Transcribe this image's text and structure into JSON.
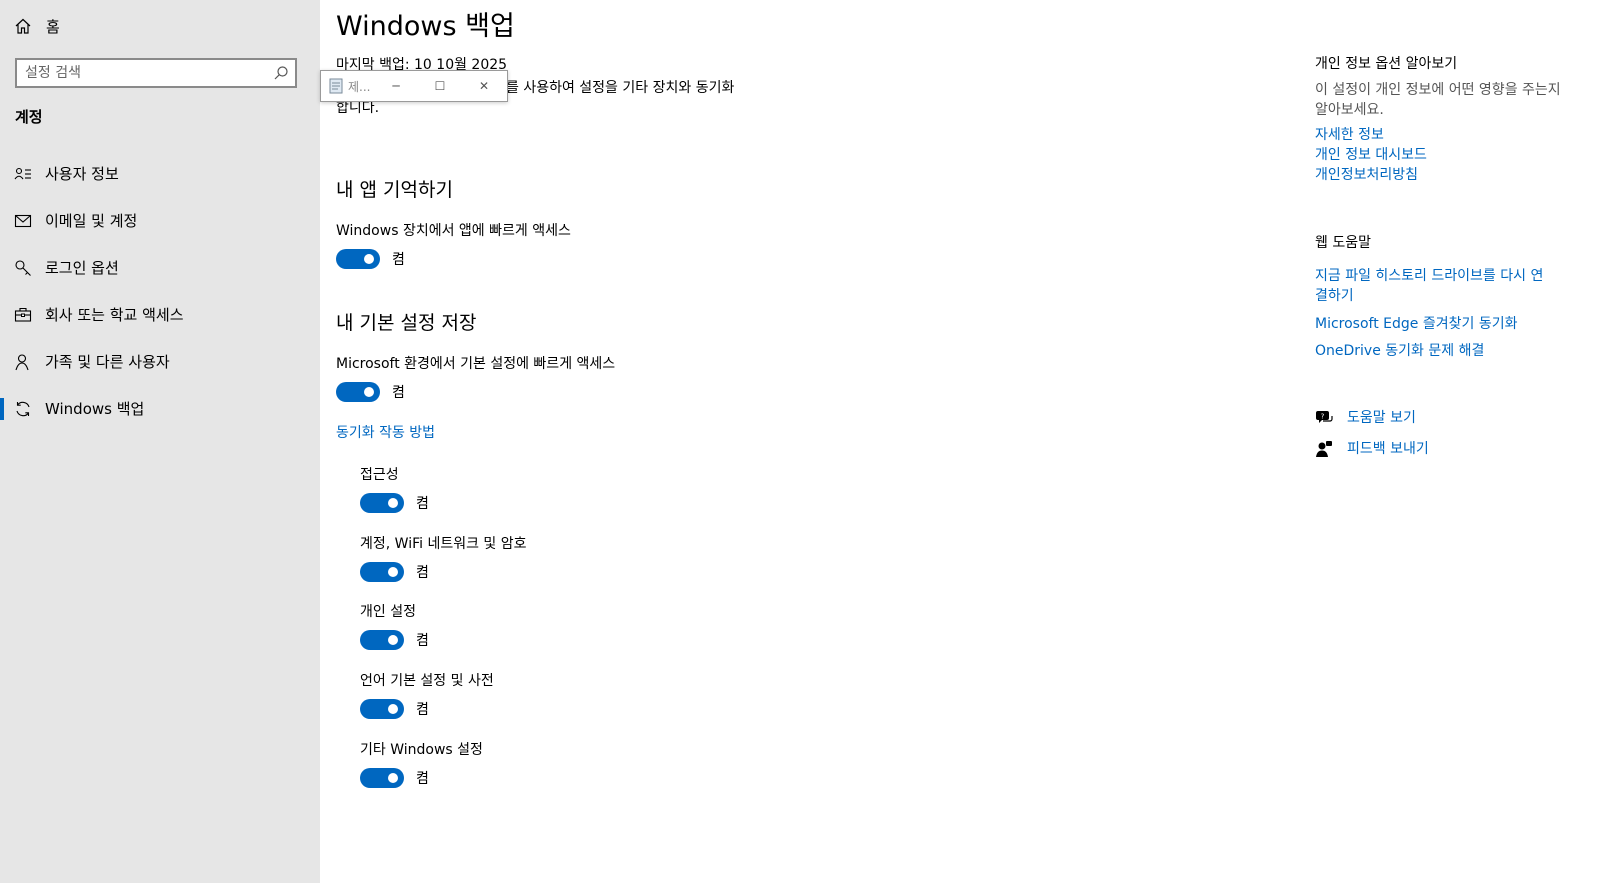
{
  "sidebar": {
    "home_label": "홈",
    "search_placeholder": "설정 검색",
    "section_title": "계정",
    "items": [
      {
        "label": "사용자 정보",
        "icon": "user-info-icon"
      },
      {
        "label": "이메일 및 계정",
        "icon": "mail-icon"
      },
      {
        "label": "로그인 옵션",
        "icon": "key-icon"
      },
      {
        "label": "회사 또는 학교 액세스",
        "icon": "briefcase-icon"
      },
      {
        "label": "가족 및 다른 사용자",
        "icon": "person-icon"
      },
      {
        "label": "Windows 백업",
        "icon": "sync-icon",
        "active": true
      }
    ]
  },
  "main": {
    "title": "Windows 백업",
    "last_backup": "마지막 백업: 10 10월 2025",
    "description_line1": "를 사용하여 설정을 기타 장치와 동기화",
    "description_line2": "합니다.",
    "remember_apps": {
      "heading": "내 앱 기억하기",
      "label": "Windows 장치에서 앱에 빠르게 액세스",
      "state": "켬"
    },
    "save_prefs": {
      "heading": "내 기본 설정 저장",
      "label": "Microsoft 환경에서 기본 설정에 빠르게 액세스",
      "state": "켬",
      "how_sync_link": "동기화 작동 방법",
      "subitems": [
        {
          "label": "접근성",
          "state": "켬"
        },
        {
          "label": "계정, WiFi 네트워크 및 암호",
          "state": "켬"
        },
        {
          "label": "개인 설정",
          "state": "켬"
        },
        {
          "label": "언어 기본 설정 및 사전",
          "state": "켬"
        },
        {
          "label": "기타 Windows 설정",
          "state": "켬"
        }
      ]
    }
  },
  "mini_window": {
    "title": "제...",
    "minimize": "─",
    "maximize": "☐",
    "close": "✕"
  },
  "right": {
    "privacy_heading": "개인 정보 옵션 알아보기",
    "privacy_text": "이 설정이 개인 정보에 어떤 영향을 주는지 알아보세요.",
    "privacy_links": [
      "자세한 정보",
      "개인 정보 대시보드",
      "개인정보처리방침"
    ],
    "web_help_heading": "웹 도움말",
    "web_help_links": [
      "지금 파일 히스토리 드라이브를 다시 연결하기",
      "Microsoft Edge 즐겨찾기 동기화",
      "OneDrive 동기화 문제 해결"
    ],
    "get_help": "도움말 보기",
    "send_feedback": "피드백 보내기"
  },
  "colors": {
    "accent": "#0067c0",
    "sidebar_bg": "#e6e6e6"
  }
}
